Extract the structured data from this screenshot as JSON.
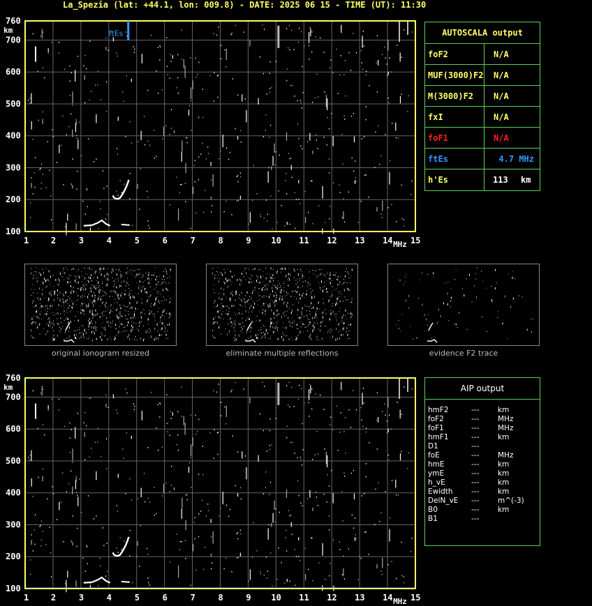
{
  "header": {
    "title": "La_Spezia (lat: +44.1, lon: 009.8) - DATE: 2025 06 15 - TIME (UT): 11:30"
  },
  "ionogram": {
    "y_axis_unit": "km",
    "y_ticks": [
      "760",
      "700",
      "600",
      "500",
      "400",
      "300",
      "200",
      "100"
    ],
    "x_ticks": [
      "1",
      "2",
      "3",
      "4",
      "5",
      "6",
      "7",
      "8",
      "9",
      "10",
      "11",
      "12",
      "13",
      "14",
      "15"
    ],
    "x_unit": "MHz",
    "ftes_marker_label": "ftEs",
    "ftes_marker_freq_mhz": 4.7,
    "colors": {
      "frame": "#ffff66",
      "grid": "#666666",
      "marker": "#3399ff"
    }
  },
  "autoscala": {
    "title": "AUTOSCALA output",
    "rows": [
      {
        "label": "foF2",
        "value": "N/A",
        "unit": "",
        "color": "#ffff66",
        "value_color": "#ffff66"
      },
      {
        "label": "MUF(3000)F2",
        "value": "N/A",
        "unit": "",
        "color": "#ffff66",
        "value_color": "#ffff66"
      },
      {
        "label": "M(3000)F2",
        "value": "N/A",
        "unit": "",
        "color": "#ffff66",
        "value_color": "#ffff66"
      },
      {
        "label": "fxI",
        "value": "N/A",
        "unit": "",
        "color": "#ffff66",
        "value_color": "#ffff66"
      },
      {
        "label": "foF1",
        "value": "N/A",
        "unit": "",
        "color": "#ff2020",
        "value_color": "#ff2020"
      },
      {
        "label": "ftEs",
        "value": "4.7",
        "unit": "MHz",
        "color": "#3399ff",
        "value_color": "#3399ff"
      },
      {
        "label": "h'Es",
        "value": "113",
        "unit": "km",
        "color": "#ffff66",
        "value_color": "#ffffff"
      }
    ]
  },
  "thumbnails": [
    {
      "caption": "original ionogram resized"
    },
    {
      "caption": "eliminate multiple reflections"
    },
    {
      "caption": "evidence F2 trace"
    }
  ],
  "aip": {
    "title": "AIP output",
    "rows": [
      {
        "param": "hmF2",
        "value": "---",
        "unit": "km"
      },
      {
        "param": "foF2",
        "value": "---",
        "unit": "MHz"
      },
      {
        "param": "foF1",
        "value": "---",
        "unit": "MHz"
      },
      {
        "param": "hmF1",
        "value": "---",
        "unit": "km"
      },
      {
        "param": "D1",
        "value": "---",
        "unit": ""
      },
      {
        "param": "foE",
        "value": "---",
        "unit": "MHz"
      },
      {
        "param": "hmE",
        "value": "---",
        "unit": "km"
      },
      {
        "param": "ymE",
        "value": "---",
        "unit": "km"
      },
      {
        "param": "h_vE",
        "value": "---",
        "unit": "km"
      },
      {
        "param": "Ewidth",
        "value": "---",
        "unit": "km"
      },
      {
        "param": "DelN_vE",
        "value": "---",
        "unit": "m^(-3)"
      },
      {
        "param": "B0",
        "value": "---",
        "unit": "km"
      },
      {
        "param": "B1",
        "value": "---",
        "unit": ""
      }
    ]
  }
}
